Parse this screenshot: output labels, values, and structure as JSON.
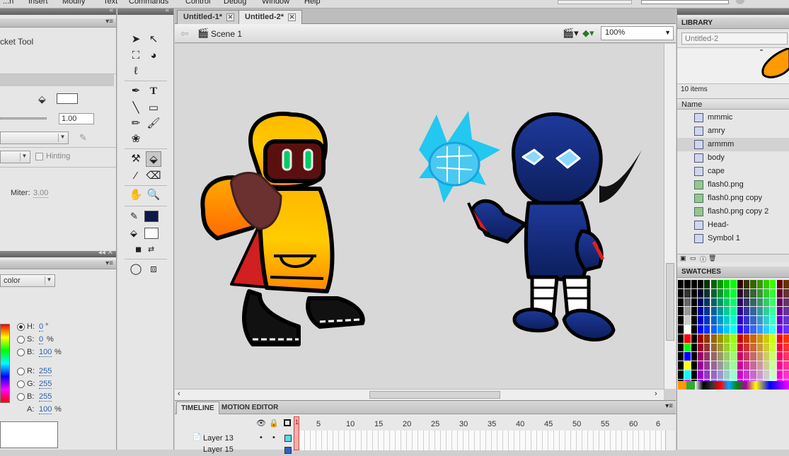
{
  "menubar": {
    "items": [
      "...n",
      "Insert",
      "Modify",
      "Text",
      "Commands",
      "Control",
      "Debug",
      "Window",
      "Help"
    ]
  },
  "properties": {
    "tool_name": "cket Tool",
    "stroke_width": "1.00",
    "hinting_label": "Hinting",
    "miter_label": "Miter:",
    "miter_value": "3.00"
  },
  "color_panel": {
    "type_label": "color",
    "h_label": "H:",
    "h_value": "0",
    "h_unit": "°",
    "s_label": "S:",
    "s_value": "0",
    "s_unit": "%",
    "b_label": "B:",
    "b_value": "100",
    "b_unit": "%",
    "r_label": "R:",
    "r_value": "255",
    "g_label": "G:",
    "g_value": "255",
    "bb_label": "B:",
    "bb_value": "255",
    "a_label": "A:",
    "a_value": "100",
    "a_unit": "%"
  },
  "tools": {
    "text_tool": "T",
    "stroke_color": "#0b1a4a",
    "fill_color": "#ffffff"
  },
  "tabs": [
    {
      "label": "Untitled-1*"
    },
    {
      "label": "Untitled-2*"
    }
  ],
  "editbar": {
    "scene_label": "Scene 1",
    "zoom_value": "100%"
  },
  "timeline": {
    "tab_timeline": "TIMELINE",
    "tab_motion": "MOTION EDITOR",
    "frame_numbers": [
      "1",
      "5",
      "10",
      "15",
      "20",
      "25",
      "30",
      "35",
      "40",
      "45",
      "50",
      "55",
      "60",
      "6"
    ],
    "layers": [
      {
        "name": "Layer 13",
        "color": "#5ad8e8"
      },
      {
        "name": "Layer 15",
        "color": "#3060d0"
      }
    ]
  },
  "library": {
    "title": "LIBRARY",
    "doc_select": "Untitled-2",
    "count_text": "10 items",
    "column_name": "Name",
    "items": [
      {
        "name": "mmmic",
        "type": "symbol"
      },
      {
        "name": "amry",
        "type": "symbol"
      },
      {
        "name": "armmm",
        "type": "symbol"
      },
      {
        "name": "body",
        "type": "symbol"
      },
      {
        "name": "cape",
        "type": "symbol"
      },
      {
        "name": "flash0.png",
        "type": "bitmap"
      },
      {
        "name": "flash0.png copy",
        "type": "bitmap"
      },
      {
        "name": "flash0.png copy 2",
        "type": "bitmap"
      },
      {
        "name": "Head-",
        "type": "symbol"
      },
      {
        "name": "Symbol 1",
        "type": "symbol"
      }
    ]
  },
  "swatches": {
    "title": "SWATCHES"
  }
}
